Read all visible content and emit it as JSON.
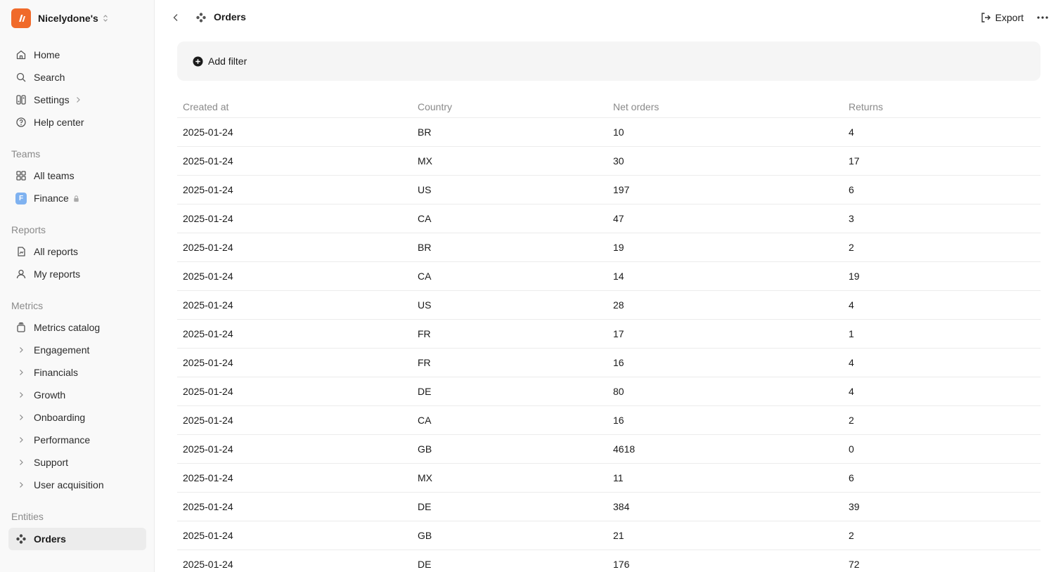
{
  "workspace": {
    "name": "Nicelydone's"
  },
  "nav": {
    "home": "Home",
    "search": "Search",
    "settings": "Settings",
    "help": "Help center"
  },
  "teams": {
    "heading": "Teams",
    "all": "All teams",
    "finance": "Finance",
    "finance_badge": "F"
  },
  "reports": {
    "heading": "Reports",
    "all": "All reports",
    "mine": "My reports"
  },
  "metrics": {
    "heading": "Metrics",
    "catalog": "Metrics catalog",
    "groups": [
      "Engagement",
      "Financials",
      "Growth",
      "Onboarding",
      "Performance",
      "Support",
      "User acquisition"
    ]
  },
  "entities": {
    "heading": "Entities",
    "orders": "Orders"
  },
  "header": {
    "title": "Orders",
    "export_label": "Export"
  },
  "filter": {
    "add_label": "Add filter"
  },
  "table": {
    "columns": [
      "Created at",
      "Country",
      "Net orders",
      "Returns"
    ],
    "rows": [
      [
        "2025-01-24",
        "BR",
        "10",
        "4"
      ],
      [
        "2025-01-24",
        "MX",
        "30",
        "17"
      ],
      [
        "2025-01-24",
        "US",
        "197",
        "6"
      ],
      [
        "2025-01-24",
        "CA",
        "47",
        "3"
      ],
      [
        "2025-01-24",
        "BR",
        "19",
        "2"
      ],
      [
        "2025-01-24",
        "CA",
        "14",
        "19"
      ],
      [
        "2025-01-24",
        "US",
        "28",
        "4"
      ],
      [
        "2025-01-24",
        "FR",
        "17",
        "1"
      ],
      [
        "2025-01-24",
        "FR",
        "16",
        "4"
      ],
      [
        "2025-01-24",
        "DE",
        "80",
        "4"
      ],
      [
        "2025-01-24",
        "CA",
        "16",
        "2"
      ],
      [
        "2025-01-24",
        "GB",
        "4618",
        "0"
      ],
      [
        "2025-01-24",
        "MX",
        "11",
        "6"
      ],
      [
        "2025-01-24",
        "DE",
        "384",
        "39"
      ],
      [
        "2025-01-24",
        "GB",
        "21",
        "2"
      ],
      [
        "2025-01-24",
        "DE",
        "176",
        "72"
      ]
    ]
  },
  "icons": {
    "logo": "brand-logo-icon",
    "home": "home-icon",
    "search": "search-icon",
    "settings": "settings-icon",
    "help": "help-circle-icon",
    "teams": "grid-icon",
    "lock": "lock-icon",
    "reports": "report-icon",
    "user": "user-icon",
    "catalog": "stack-icon",
    "chevron": "chevron-right-icon",
    "entity": "entity-icon",
    "back": "chevron-left-icon",
    "export": "export-icon",
    "more": "more-horizontal-icon",
    "add": "plus-circle-icon"
  },
  "colors": {
    "brand": "#f06a2a",
    "finance_badge": "#7fb2f0",
    "sidebar_bg": "#f9f9f9",
    "active_bg": "#ececec"
  }
}
